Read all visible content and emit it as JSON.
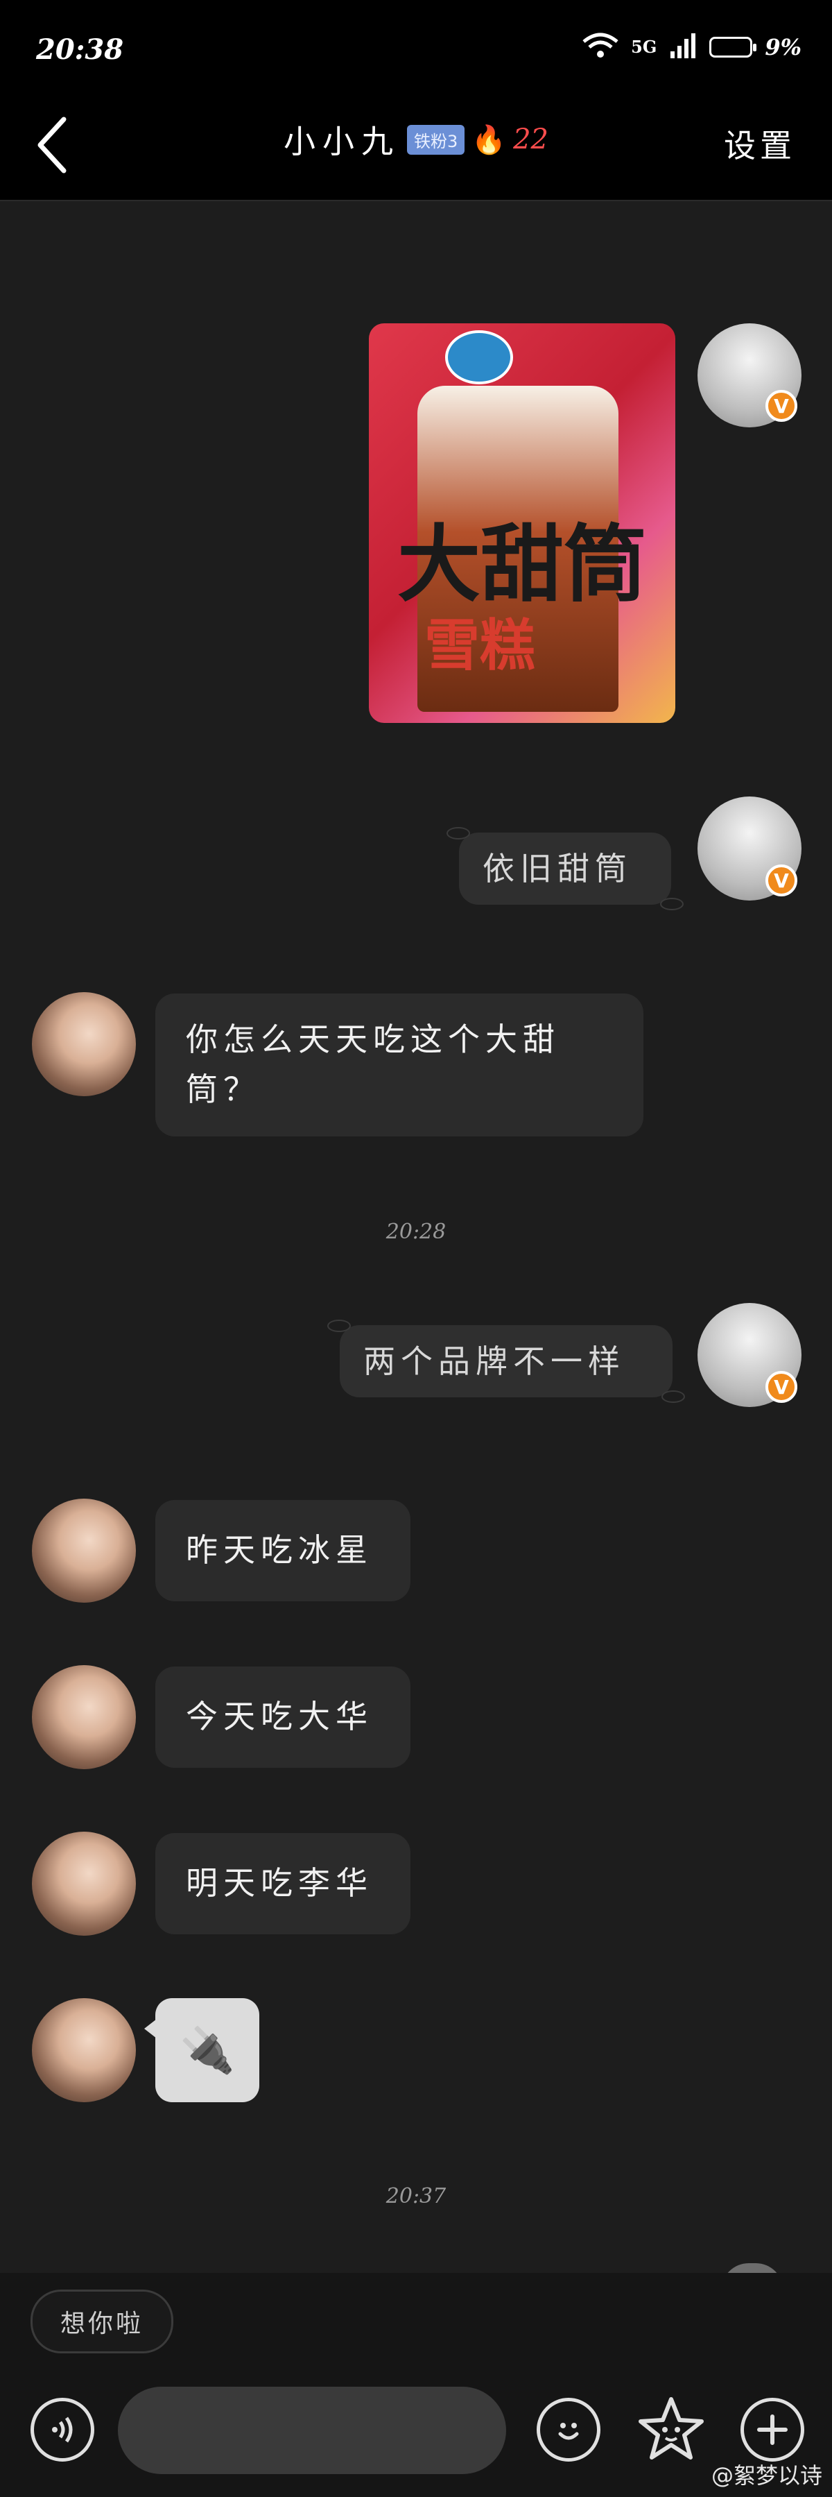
{
  "status": {
    "time": "20:38",
    "network": "5G",
    "battery": "9%"
  },
  "header": {
    "title": "小小九",
    "badge": "铁粉3",
    "flame": "🔥",
    "streak": "22",
    "settings": "设置"
  },
  "messages": {
    "m_photo_alt": "大甜筒雪糕",
    "m1": "依旧甜筒",
    "m2": "你怎么天天吃这个大甜筒？",
    "ts1": "20:28",
    "m3": "两个品牌不一样",
    "m4": "昨天吃冰星",
    "m5": "今天吃大华",
    "m6": "明天吃李华",
    "m7": "🔌",
    "ts2": "20:37"
  },
  "photo_text": {
    "line1": "大甜筒",
    "line2": "雪糕"
  },
  "bottom": {
    "quick_reply": "想你啦",
    "input_placeholder": ""
  },
  "watermark": "@絮梦以诗",
  "colors": {
    "background": "#1d1d1d",
    "bubble": "#2b2b2b",
    "vip_badge": "#f08a1c",
    "fan_badge": "#6b8fd6"
  }
}
